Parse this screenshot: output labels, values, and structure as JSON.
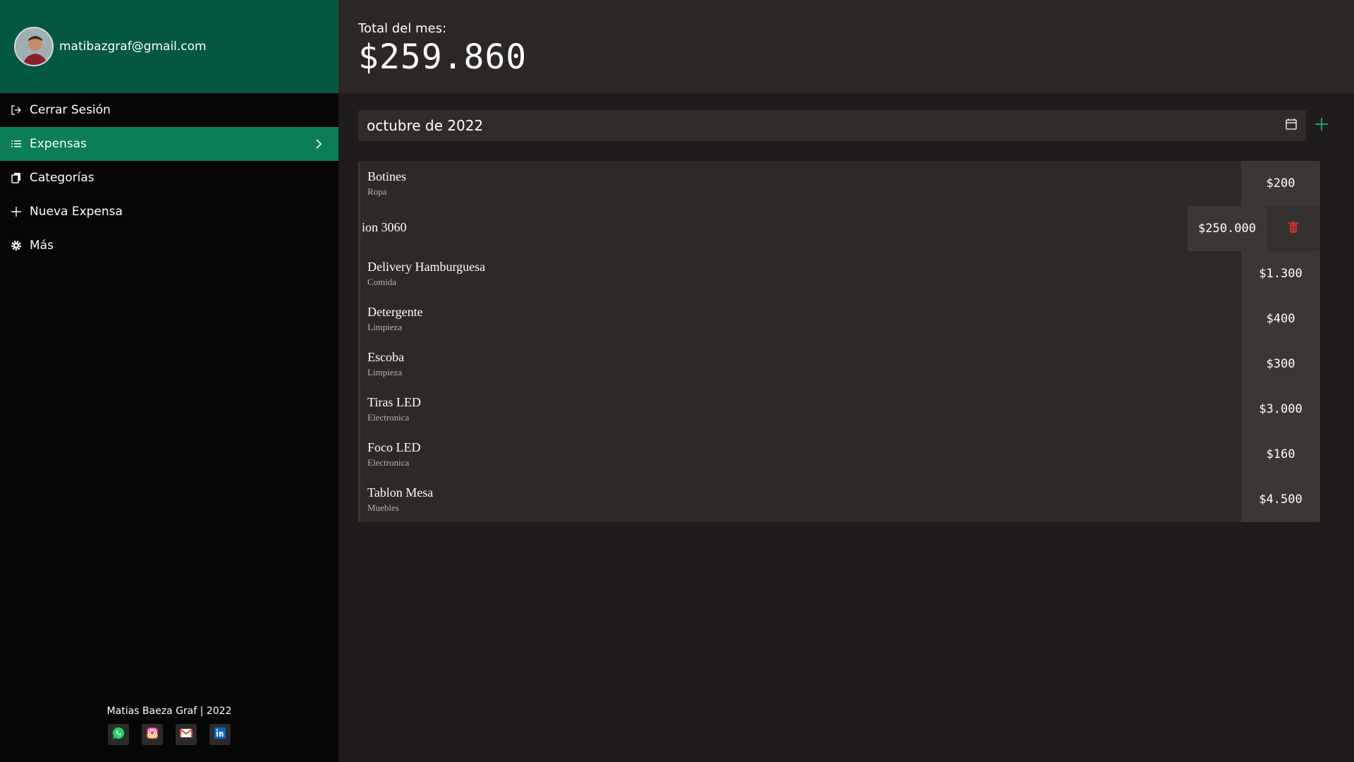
{
  "user": {
    "email": "matibazgraf@gmail.com"
  },
  "nav": [
    {
      "label": "Cerrar Sesión",
      "icon": "logout-icon"
    },
    {
      "label": "Expensas",
      "icon": "list-icon",
      "active": true
    },
    {
      "label": "Categorías",
      "icon": "copy-icon"
    },
    {
      "label": "Nueva Expensa",
      "icon": "plus-icon"
    },
    {
      "label": "Más",
      "icon": "gear-icon"
    }
  ],
  "footer": {
    "text": "Matias Baeza Graf | 2022",
    "socials": [
      "whatsapp-icon",
      "instagram-icon",
      "gmail-icon",
      "linkedin-icon"
    ]
  },
  "header": {
    "total_label": "Total del mes:",
    "total_value": "$259.860"
  },
  "month": {
    "value": "octubre de 2022"
  },
  "expenses": [
    {
      "name": "Botines",
      "category": "Ropa",
      "amount": "$200"
    },
    {
      "name": "ion 3060",
      "category": "",
      "amount": "$250.000"
    },
    {
      "name": "Delivery Hamburguesa",
      "category": "Comida",
      "amount": "$1.300"
    },
    {
      "name": "Detergente",
      "category": "Limpieza",
      "amount": "$400"
    },
    {
      "name": "Escoba",
      "category": "Limpieza",
      "amount": "$300"
    },
    {
      "name": "Tiras LED",
      "category": "Electronica",
      "amount": "$3.000"
    },
    {
      "name": "Foco LED",
      "category": "Electronica",
      "amount": "$160"
    },
    {
      "name": "Tablon Mesa",
      "category": "Muebles",
      "amount": "$4.500"
    }
  ],
  "colors": {
    "brand_green": "#03593f",
    "active_green": "#0b7d58",
    "delete_red": "#d32f2f",
    "accent_add": "#16a36b"
  }
}
